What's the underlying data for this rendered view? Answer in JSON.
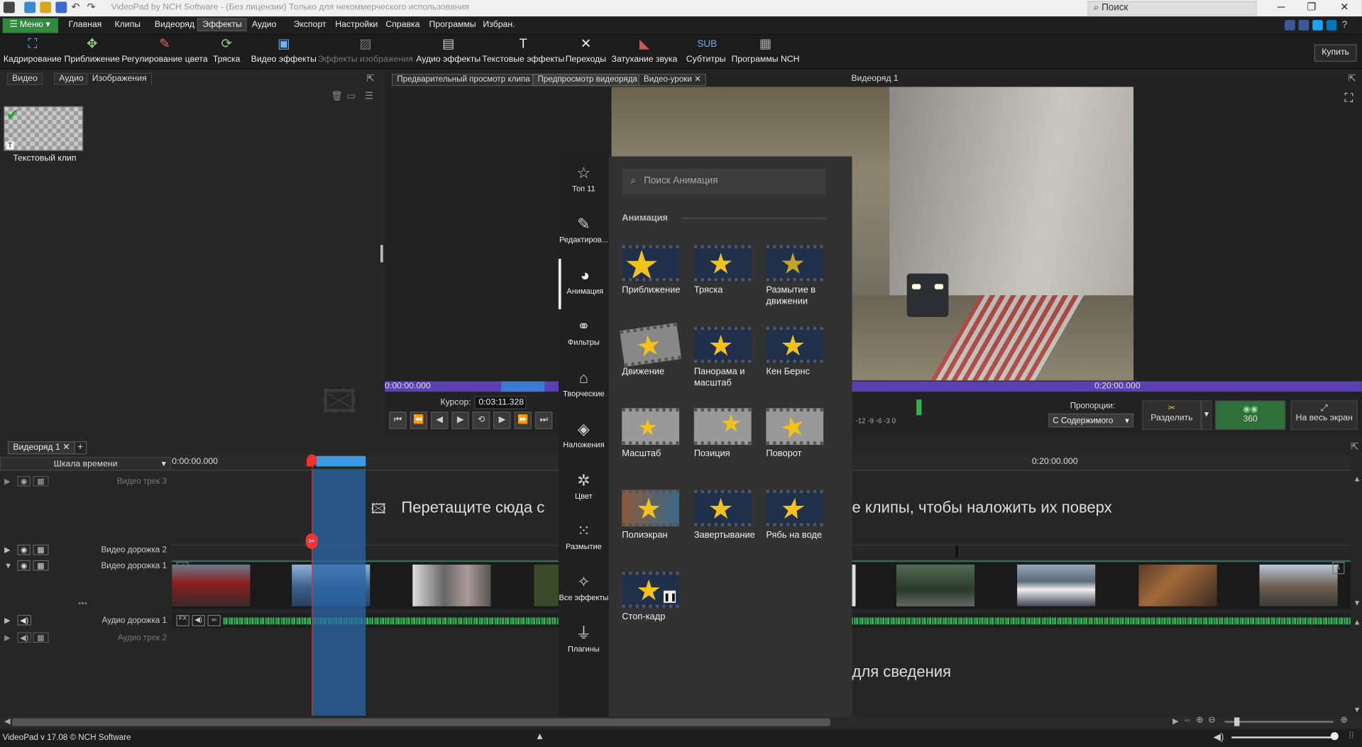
{
  "titlebar": {
    "title": "VideoPad by NCH Software - (Без лицензии) Только для некоммерческого использования",
    "search_placeholder": "Поиск"
  },
  "menubar": {
    "menu_label": "Меню",
    "tabs": [
      "Главная",
      "Клипы",
      "Видеоряд",
      "Эффекты",
      "Аудио",
      "Экспорт",
      "Настройки",
      "Справка",
      "Программы",
      "Избран."
    ],
    "active_tab": "Эффекты"
  },
  "toolbar": {
    "items": [
      "Кадрирование",
      "Приближение",
      "Регулирование цвета",
      "Тряска",
      "Видео эффекты",
      "Эффекты изображения",
      "Аудио эффекты",
      "Текстовые эффекты",
      "Переходы",
      "Затухание звука",
      "Субтитры",
      "Программы NCH"
    ],
    "buy_label": "Купить"
  },
  "media": {
    "tabs": [
      "Видео",
      "Аудио",
      "Изображения"
    ],
    "clip_name": "Текстовый клип"
  },
  "preview": {
    "tabs": [
      "Предварительный просмотр клипа",
      "Предпросмотр видеоряда",
      "Видео-уроки"
    ],
    "sequence_title": "Видеоряд 1",
    "time_start": "0:00:00.000",
    "time_end": "0:20:00.000",
    "cursor_label": "Курсор:",
    "cursor_value": "0:03:11.328",
    "proportions_label": "Пропорции:",
    "proportions_value": "С Содержимого",
    "split_label": "Разделить",
    "vr_label": "360",
    "fullscreen_label": "На весь экран",
    "level_marks": "-12  -9  -6  -3  0"
  },
  "timeline": {
    "seq_tab": "Видеоряд 1",
    "scale_label": "Шкала времени",
    "time_start": "0:00:00.000",
    "time_mark": "0:20:00.000",
    "tracks": [
      "Видео трек 3",
      "Видео дорожка 2",
      "Видео дорожка 1",
      "Аудио дорожка 1",
      "Аудио трек 2"
    ],
    "drag_overlay": "Перетащите сюда с",
    "drag_overlay_tail": "е клипы, чтобы наложить их поверх",
    "drag_audio_tail": "для сведения"
  },
  "statusbar": {
    "version": "VideoPad v 17.08 © NCH Software"
  },
  "effects_panel": {
    "nav": [
      "Топ 11",
      "Редактиров...",
      "Анимация",
      "Фильтры",
      "Творческие",
      "Наложения",
      "Цвет",
      "Размытие",
      "Все эффекты",
      "Плагины"
    ],
    "search_placeholder": "Поиск Анимация",
    "section": "Анимация",
    "items": [
      "Приближение",
      "Тряска",
      "Размытие в движении",
      "Движение",
      "Панорама и масштаб",
      "Кен Бернс",
      "Масштаб",
      "Позиция",
      "Поворот",
      "Полиэкран",
      "Завертывание",
      "Рябь на воде",
      "Стоп-кадр"
    ]
  }
}
